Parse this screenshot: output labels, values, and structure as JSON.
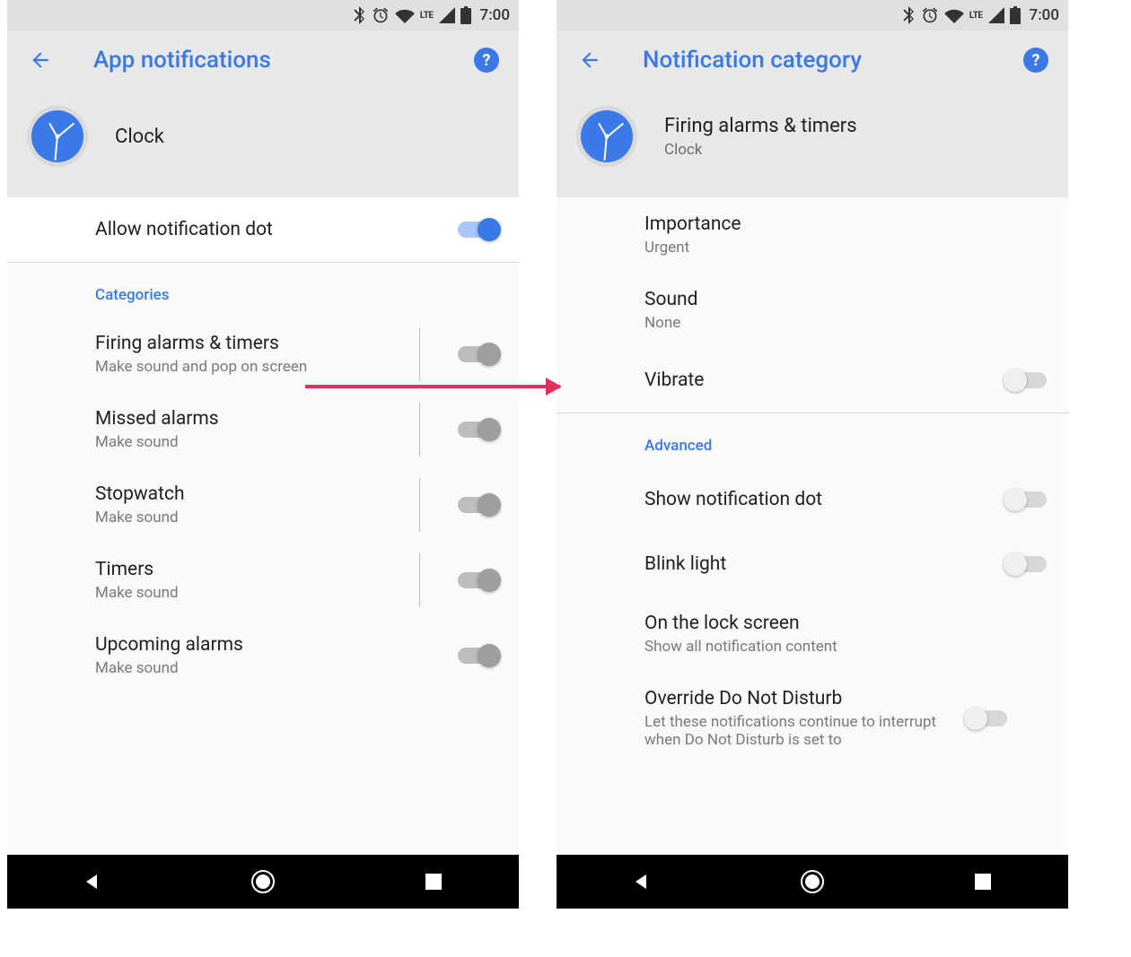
{
  "status": {
    "lte": "LTE",
    "time": "7:00"
  },
  "left": {
    "title": "App notifications",
    "app_name": "Clock",
    "allow_dot": {
      "label": "Allow notification dot",
      "on": true
    },
    "section": "Categories",
    "categories": [
      {
        "title": "Firing alarms & timers",
        "sub": "Make sound and pop on screen"
      },
      {
        "title": "Missed alarms",
        "sub": "Make sound"
      },
      {
        "title": "Stopwatch",
        "sub": "Make sound"
      },
      {
        "title": "Timers",
        "sub": "Make sound"
      },
      {
        "title": "Upcoming alarms",
        "sub": "Make sound"
      }
    ]
  },
  "right": {
    "title": "Notification category",
    "header_title": "Firing alarms & timers",
    "header_sub": "Clock",
    "items": {
      "importance": {
        "label": "Importance",
        "value": "Urgent"
      },
      "sound": {
        "label": "Sound",
        "value": "None"
      },
      "vibrate": {
        "label": "Vibrate"
      }
    },
    "advanced_label": "Advanced",
    "advanced": {
      "show_dot": {
        "label": "Show notification dot"
      },
      "blink": {
        "label": "Blink light"
      },
      "lock": {
        "label": "On the lock screen",
        "sub": "Show all notification content"
      },
      "dnd": {
        "label": "Override Do Not Disturb",
        "sub": "Let these notifications continue to interrupt when Do Not Disturb is set to"
      }
    }
  }
}
